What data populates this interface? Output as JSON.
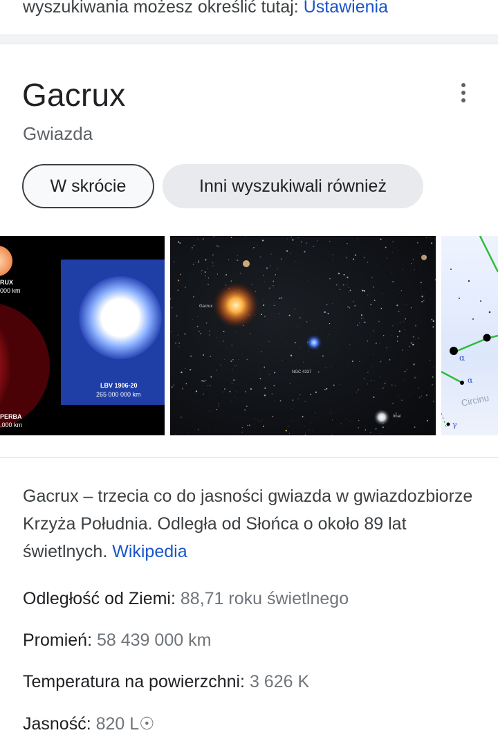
{
  "top_banner": {
    "text": "wyszukiwania możesz określić tutaj:",
    "link": "Ustawienia"
  },
  "panel": {
    "title": "Gacrux",
    "subtitle": "Gwiazda",
    "more_icon": "more-vert-icon",
    "chips": [
      {
        "label": "W skrócie",
        "selected": true
      },
      {
        "label": "Inni wyszukiwali również",
        "selected": false
      }
    ]
  },
  "images": {
    "img1": {
      "labels": {
        "gacrux": "RUX",
        "gacrux_size": "000 km",
        "lbv_name": "LBV 1906-20",
        "lbv_size": "265 000 000 km",
        "hyperba": "PERBA",
        "hyperba_size": ".000 km"
      }
    },
    "img2": {
      "labels": {
        "gacrux": "Gacrux",
        "ngc": "NGC 4337",
        "imai": "Imai"
      }
    },
    "img3": {
      "labels": {
        "alpha1": "α",
        "alpha2": "α",
        "gamma": "γ",
        "circinus": "Circinu"
      }
    }
  },
  "description": {
    "text": "Gacrux – trzecia co do jasności gwiazda w gwiazdozbiorze Krzyża Południa. Odległa od Słońca o około 89 lat świetlnych.",
    "source": "Wikipedia"
  },
  "facts": [
    {
      "label": "Odległość od Ziemi:",
      "value": "88,71 roku świetlnego"
    },
    {
      "label": "Promień:",
      "value": "58 439 000 km"
    },
    {
      "label": "Temperatura na powierzchni:",
      "value": "3 626 K"
    },
    {
      "label": "Jasność:",
      "value": "820 L☉"
    }
  ],
  "colors": {
    "link": "#1a55c8",
    "text": "#202124",
    "secondary": "#70757a"
  }
}
